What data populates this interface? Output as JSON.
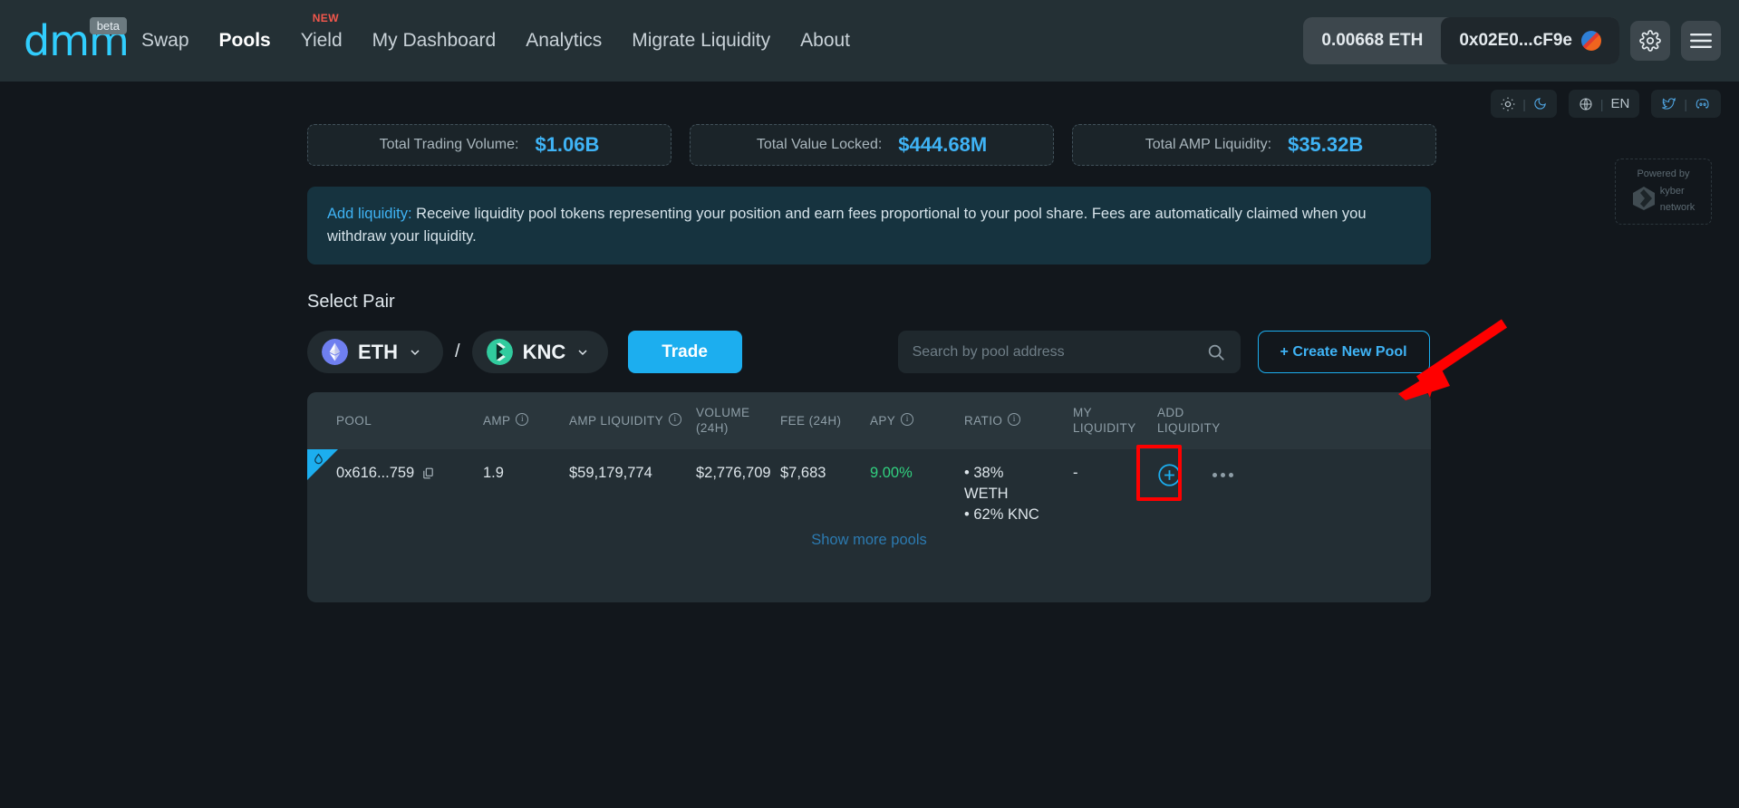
{
  "header": {
    "logo_text": "dmm",
    "logo_badge": "beta",
    "nav": [
      {
        "label": "Swap",
        "active": false,
        "badge": ""
      },
      {
        "label": "Pools",
        "active": true,
        "badge": ""
      },
      {
        "label": "Yield",
        "active": false,
        "badge": "NEW"
      },
      {
        "label": "My Dashboard",
        "active": false,
        "badge": ""
      },
      {
        "label": "Analytics",
        "active": false,
        "badge": ""
      },
      {
        "label": "Migrate Liquidity",
        "active": false,
        "badge": ""
      },
      {
        "label": "About",
        "active": false,
        "badge": ""
      }
    ],
    "wallet_balance": "0.00668 ETH",
    "wallet_address": "0x02E0...cF9e",
    "settings_icon": "gear-icon",
    "menu_icon": "hamburger-icon"
  },
  "float_controls": {
    "theme_sun_icon": "sun-icon",
    "theme_moon_icon": "moon-icon",
    "globe_icon": "globe-icon",
    "language": "EN",
    "twitter_icon": "twitter-icon",
    "discord_icon": "discord-icon",
    "powered_by": "Powered by",
    "powered_brand_line1": "kyber",
    "powered_brand_line2": "network"
  },
  "stats": [
    {
      "label": "Total Trading Volume:",
      "value": "$1.06B"
    },
    {
      "label": "Total Value Locked:",
      "value": "$444.68M"
    },
    {
      "label": "Total AMP Liquidity:",
      "value": "$35.32B"
    }
  ],
  "notice": {
    "link_text": "Add liquidity:",
    "body": "Receive liquidity pool tokens representing your position and earn fees proportional to your pool share. Fees are automatically claimed when you withdraw your liquidity."
  },
  "select_pair": {
    "title": "Select Pair",
    "token_a": "ETH",
    "token_b": "KNC",
    "separator": "/",
    "trade_label": "Trade"
  },
  "search": {
    "placeholder": "Search by pool address",
    "value": "",
    "icon": "search-icon"
  },
  "create_pool_label": "+ Create New Pool",
  "table": {
    "columns": [
      {
        "label": "POOL",
        "info": false
      },
      {
        "label": "AMP",
        "info": true
      },
      {
        "label": "AMP LIQUIDITY",
        "info": true
      },
      {
        "label": "VOLUME (24H)",
        "info": false
      },
      {
        "label": "FEE (24H)",
        "info": false
      },
      {
        "label": "APY",
        "info": true
      },
      {
        "label": "RATIO",
        "info": true
      },
      {
        "label": "MY LIQUIDITY",
        "info": false
      },
      {
        "label": "ADD LIQUIDITY",
        "info": false
      }
    ],
    "rows": [
      {
        "pool": "0x616...759",
        "amp": "1.9",
        "amp_liquidity": "$59,179,774",
        "volume_24h": "$2,776,709",
        "fee_24h": "$7,683",
        "apy": "9.00%",
        "ratio_line1": "• 38% WETH",
        "ratio_line2": "• 62% KNC",
        "my_liquidity": "-",
        "add_icon": "plus-circle-icon",
        "more_icon": "ellipsis-icon",
        "copy_icon": "copy-icon"
      }
    ],
    "show_more_label": "Show more pools"
  },
  "colors": {
    "accent_blue": "#1caeef",
    "value_blue": "#3fb3f5",
    "apy_green": "#31d07f",
    "header_bg": "#243035",
    "page_bg": "#12171c",
    "card_bg": "#232e34",
    "notice_bg": "#16333f",
    "annotation_red": "#ff0000",
    "badge_red": "#f2574c"
  }
}
